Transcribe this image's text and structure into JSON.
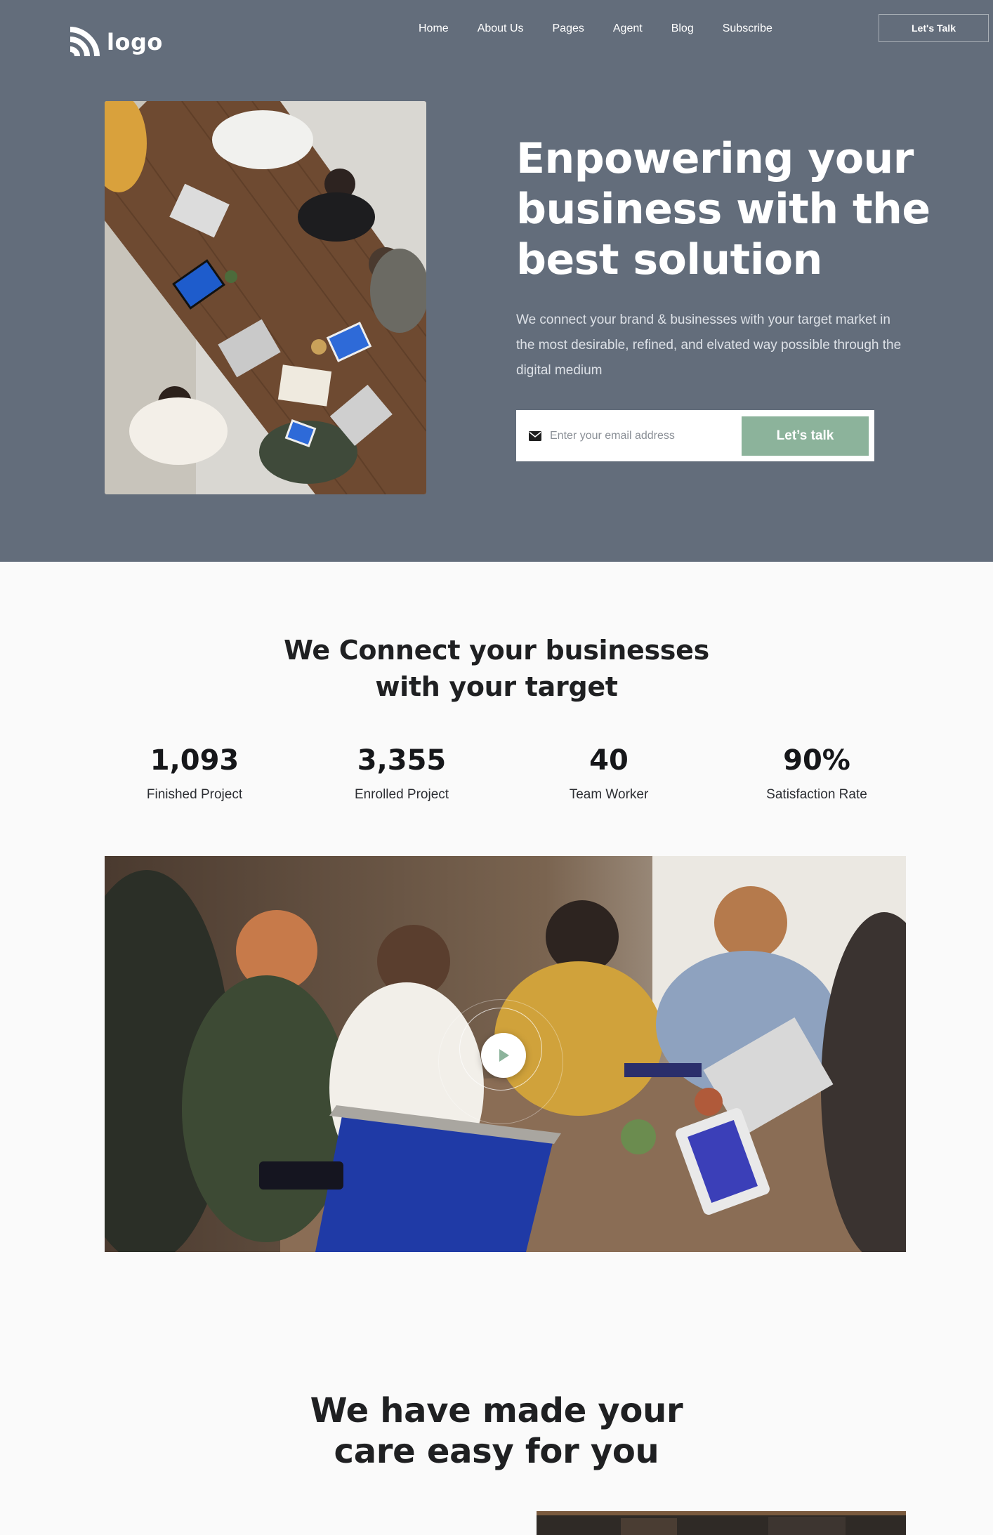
{
  "header": {
    "logo_text": "logo",
    "nav": [
      "Home",
      "About Us",
      "Pages",
      "Agent",
      "Blog",
      "Subscribe"
    ],
    "cta_label": "Let's Talk"
  },
  "hero": {
    "title": "Enpowering your business with the best solution",
    "subtitle": "We connect your brand & businesses with your target market in the most desirable, refined, and elvated way possible through the digital medium",
    "email_placeholder": "Enter your email address",
    "email_button": "Let’s talk",
    "photo_icon": "meeting-table-photo"
  },
  "connect": {
    "title_line1": "We Connect your businesses",
    "title_line2": "with your target",
    "stats": [
      {
        "value": "1,093",
        "label": "Finished Project"
      },
      {
        "value": "3,355",
        "label": "Enrolled Project"
      },
      {
        "value": "40",
        "label": "Team Worker"
      },
      {
        "value": "90%",
        "label": "Satisfaction Rate"
      }
    ],
    "video_icon": "play-icon"
  },
  "care": {
    "title_line1": "We have made your",
    "title_line2": "care easy for you"
  },
  "colors": {
    "hero_bg": "#636d7b",
    "accent_green": "#8cb39b",
    "page_bg": "#fafafa",
    "text_dark": "#1f2022"
  }
}
